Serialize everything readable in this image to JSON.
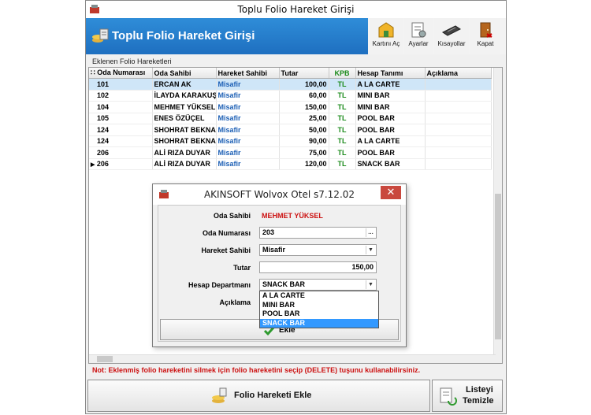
{
  "window": {
    "title": "Toplu Folio Hareket Girişi"
  },
  "header": {
    "title": "Toplu Folio Hareket Girişi",
    "tools": [
      {
        "label": "Kartını Aç",
        "icon": "open-card-icon"
      },
      {
        "label": "Ayarlar",
        "icon": "settings-icon"
      },
      {
        "label": "Kısayollar",
        "icon": "keyboard-icon"
      },
      {
        "label": "Kapat",
        "icon": "exit-door-icon"
      }
    ]
  },
  "section_label": "Eklenen Folio Hareketleri",
  "grid": {
    "columns": [
      "Oda Numarası",
      "Oda Sahibi",
      "Hareket Sahibi",
      "Tutar",
      "KPB",
      "Hesap Tanımı",
      "Açıklama"
    ],
    "rows": [
      {
        "oda": "101",
        "sahibi": "ERCAN AK",
        "hareket": "Misafir",
        "tutar": "100,00",
        "kpb": "TL",
        "hesap": "A LA CARTE",
        "aciklama": ""
      },
      {
        "oda": "102",
        "sahibi": "İLAYDA KARAKUŞ",
        "hareket": "Misafir",
        "tutar": "60,00",
        "kpb": "TL",
        "hesap": "MINI BAR",
        "aciklama": ""
      },
      {
        "oda": "104",
        "sahibi": "MEHMET YÜKSEL",
        "hareket": "Misafir",
        "tutar": "150,00",
        "kpb": "TL",
        "hesap": "MINI BAR",
        "aciklama": ""
      },
      {
        "oda": "105",
        "sahibi": "ENES ÖZÜÇEL",
        "hareket": "Misafir",
        "tutar": "25,00",
        "kpb": "TL",
        "hesap": "POOL BAR",
        "aciklama": ""
      },
      {
        "oda": "124",
        "sahibi": "SHOHRAT BEKNAZ",
        "hareket": "Misafir",
        "tutar": "50,00",
        "kpb": "TL",
        "hesap": "POOL BAR",
        "aciklama": ""
      },
      {
        "oda": "124",
        "sahibi": "SHOHRAT BEKNAZ",
        "hareket": "Misafir",
        "tutar": "90,00",
        "kpb": "TL",
        "hesap": "A LA CARTE",
        "aciklama": ""
      },
      {
        "oda": "206",
        "sahibi": "ALİ RIZA  DUYAR",
        "hareket": "Misafir",
        "tutar": "75,00",
        "kpb": "TL",
        "hesap": "POOL BAR",
        "aciklama": ""
      },
      {
        "oda": "206",
        "sahibi": "ALİ RIZA  DUYAR",
        "hareket": "Misafir",
        "tutar": "120,00",
        "kpb": "TL",
        "hesap": "SNACK BAR",
        "aciklama": ""
      }
    ],
    "current_row_marker": "▶"
  },
  "note": "Not: Eklenmiş folio hareketini silmek için folio hareketini seçip (DELETE) tuşunu kullanabilirsiniz.",
  "buttons": {
    "add": "Folio Hareketi Ekle",
    "clear_line1": "Listeyi",
    "clear_line2": "Temizle"
  },
  "dialog": {
    "title": "AKINSOFT Wolvox Otel s7.12.02",
    "close": "✕",
    "fields": {
      "oda_sahibi_label": "Oda Sahibi",
      "oda_sahibi_value": "MEHMET YÜKSEL",
      "oda_numarasi_label": "Oda Numarası",
      "oda_numarasi_value": "203",
      "hareket_sahibi_label": "Hareket Sahibi",
      "hareket_sahibi_value": "Misafir",
      "tutar_label": "Tutar",
      "tutar_value": "150,00",
      "hesap_label": "Hesap Departmanı",
      "hesap_value": "SNACK BAR",
      "aciklama_label": "Açıklama"
    },
    "dropdown_options": [
      "A LA CARTE",
      "MINI BAR",
      "POOL BAR",
      "SNACK BAR"
    ],
    "ekle_label": "Ekle"
  },
  "colors": {
    "header_blue": "#1e6fc0",
    "selection": "#cfe6f8",
    "note_red": "#cc1111",
    "kpb_green": "#1a8a1a",
    "dropdown_highlight": "#3399ff"
  }
}
